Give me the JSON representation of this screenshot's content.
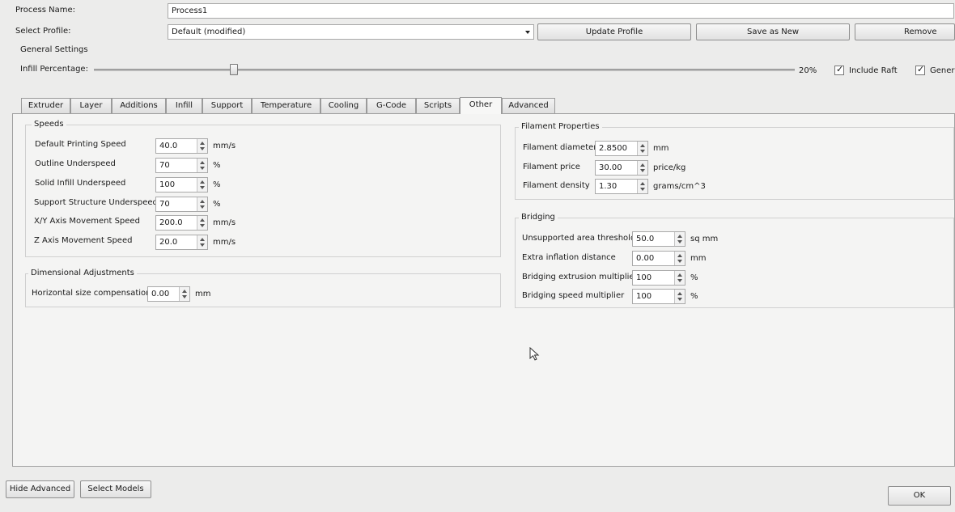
{
  "header": {
    "process_name_label": "Process Name:",
    "process_name_value": "Process1",
    "select_profile_label": "Select Profile:",
    "profile_value": "Default (modified)",
    "update_profile_label": "Update Profile",
    "save_as_new_label": "Save as New",
    "remove_label": "Remove"
  },
  "general": {
    "title": "General Settings",
    "infill_label": "Infill Percentage:",
    "infill_value": "20%",
    "infill_fraction": 0.2,
    "include_raft_label": "Include Raft",
    "include_raft_checked": true,
    "generate_label": "Gener",
    "generate_checked": true
  },
  "tabs": [
    {
      "label": "Extruder"
    },
    {
      "label": "Layer"
    },
    {
      "label": "Additions"
    },
    {
      "label": "Infill"
    },
    {
      "label": "Support"
    },
    {
      "label": "Temperature"
    },
    {
      "label": "Cooling"
    },
    {
      "label": "G-Code"
    },
    {
      "label": "Scripts"
    },
    {
      "label": "Other"
    },
    {
      "label": "Advanced"
    }
  ],
  "active_tab": "Other",
  "speeds": {
    "title": "Speeds",
    "rows": [
      {
        "label": "Default Printing Speed",
        "value": "40.0",
        "unit": "mm/s"
      },
      {
        "label": "Outline Underspeed",
        "value": "70",
        "unit": "%"
      },
      {
        "label": "Solid Infill Underspeed",
        "value": "100",
        "unit": "%"
      },
      {
        "label": "Support Structure Underspeed",
        "value": "70",
        "unit": "%"
      },
      {
        "label": "X/Y Axis Movement Speed",
        "value": "200.0",
        "unit": "mm/s"
      },
      {
        "label": "Z Axis Movement Speed",
        "value": "20.0",
        "unit": "mm/s"
      }
    ]
  },
  "dimensional": {
    "title": "Dimensional Adjustments",
    "label": "Horizontal size compensation",
    "value": "0.00",
    "unit": "mm"
  },
  "filament": {
    "title": "Filament Properties",
    "rows": [
      {
        "label": "Filament diameter",
        "value": "2.8500",
        "unit": "mm"
      },
      {
        "label": "Filament price",
        "value": "30.00",
        "unit": "price/kg"
      },
      {
        "label": "Filament density",
        "value": "1.30",
        "unit": "grams/cm^3"
      }
    ]
  },
  "bridging": {
    "title": "Bridging",
    "rows": [
      {
        "label": "Unsupported area threshold",
        "value": "50.0",
        "unit": "sq mm"
      },
      {
        "label": "Extra inflation distance",
        "value": "0.00",
        "unit": "mm"
      },
      {
        "label": "Bridging extrusion multiplier",
        "value": "100",
        "unit": "%"
      },
      {
        "label": "Bridging speed multiplier",
        "value": "100",
        "unit": "%"
      }
    ]
  },
  "footer": {
    "hide_advanced_label": "Hide Advanced",
    "select_models_label": "Select Models",
    "ok_label": "OK"
  },
  "colors": {
    "background": "#ececeb",
    "panel": "#f4f4f3",
    "border": "#a9a9a9"
  },
  "icons": {
    "spinner": "spin-arrows-icon",
    "dropdown": "chevron-down-icon",
    "checkbox": "checkmark-icon",
    "cursor": "mouse-pointer-icon"
  }
}
